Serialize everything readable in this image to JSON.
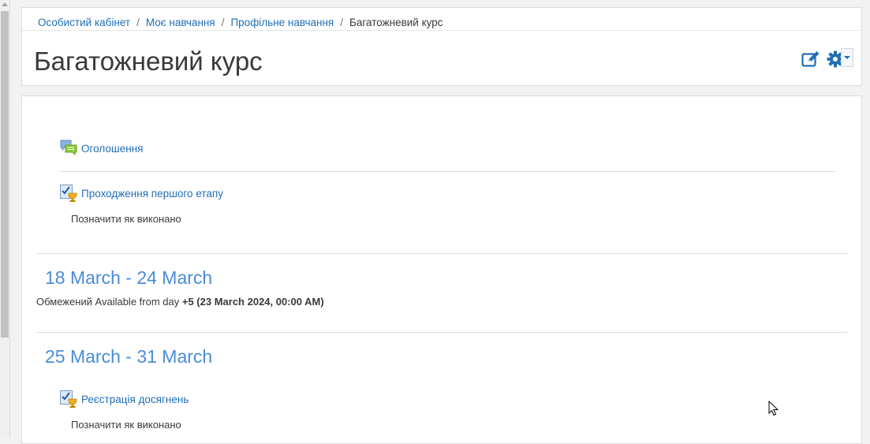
{
  "breadcrumb": {
    "items": [
      "Особистий кабінет",
      "Моє навчання",
      "Профільне навчання"
    ],
    "separator": "/",
    "current": "Багатожневий курс"
  },
  "page": {
    "title": "Багатожневий курс"
  },
  "top_section": {
    "activities": [
      {
        "label": "Оголошення",
        "icon": "forum-icon"
      },
      {
        "label": "Проходження першого етапу",
        "icon": "badge-certificate-icon",
        "completion": "Позначити як виконано"
      }
    ]
  },
  "week1": {
    "title": "18 March - 24 March",
    "restriction_prefix": "Обмежений Available from day",
    "restriction_value": "+5 (23 March 2024, 00:00 AM)"
  },
  "week2": {
    "title": "25 March - 31 March",
    "activities": [
      {
        "label": "Реєстрація досягнень",
        "icon": "badge-certificate-icon",
        "completion": "Позначити як виконано"
      }
    ]
  },
  "colors": {
    "link": "#1f6fb5",
    "section_title": "#4a8cd6",
    "text": "#373a3c"
  }
}
